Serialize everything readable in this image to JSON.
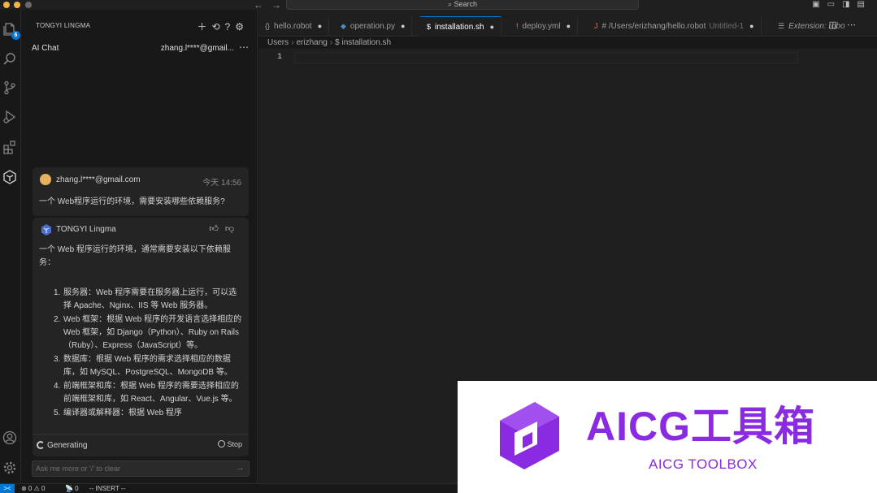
{
  "titlebar": {
    "search_placeholder": "Search",
    "colors": {
      "bg": "#1f1f1f",
      "traffic_dot": "#f2b449"
    }
  },
  "activity_bar": {
    "items": [
      {
        "icon": "files-icon",
        "badge": "6"
      },
      {
        "icon": "search-icon"
      },
      {
        "icon": "source-control-icon"
      },
      {
        "icon": "run-debug-icon"
      },
      {
        "icon": "extensions-icon"
      },
      {
        "icon": "tongyi-lingma-icon"
      }
    ],
    "bottom": [
      {
        "icon": "account-icon"
      },
      {
        "icon": "manage-gear-icon"
      }
    ]
  },
  "sidebar": {
    "header": "TONGYI LINGMA",
    "panel_title": "AI Chat",
    "account": "zhang.l****@gmail...",
    "user_message": {
      "author": "zhang.l****@gmail.com",
      "time": "今天 14:56",
      "text": "一个 Web程序运行的环境，需要安装哪些依赖服务?"
    },
    "ai_message": {
      "author": "TONGYI Lingma",
      "intro": "一个 Web 程序运行的环境，通常需要安装以下依赖服务：",
      "items": [
        {
          "num": "1.",
          "text": "服务器：Web 程序需要在服务器上运行，可以选择 Apache、Nginx、IIS 等 Web 服务器。"
        },
        {
          "num": "2.",
          "text": "Web 框架：根据 Web 程序的开发语言选择相应的 Web 框架，如 Django（Python）、Ruby on Rails（Ruby）、Express（JavaScript）等。"
        },
        {
          "num": "3.",
          "text": "数据库：根据 Web 程序的需求选择相应的数据库，如 MySQL、PostgreSQL、MongoDB 等。"
        },
        {
          "num": "4.",
          "text": "前端框架和库：根据 Web 程序的需要选择相应的前端框架和库，如 React、Angular、Vue.js 等。"
        },
        {
          "num": "5.",
          "text": "编译器或解释器：根据 Web 程序"
        }
      ],
      "status": "Generating",
      "stop_label": "Stop"
    },
    "input_placeholder": "Ask me more or '/' to clear"
  },
  "editor": {
    "tabs": [
      {
        "icon": "{}",
        "label": "hello.robot",
        "dirty": "●"
      },
      {
        "icon": "◆",
        "label": "operation.py",
        "dirty": "●"
      },
      {
        "icon": "$",
        "label": "installation.sh",
        "dirty": "●",
        "active": true
      },
      {
        "icon": "!",
        "label": "deploy.yml",
        "dirty": "●"
      },
      {
        "icon": "J",
        "label": "# /Users/erizhang/hello.robot",
        "sub": "Untitled-1",
        "dirty": "●"
      },
      {
        "icon": "☰",
        "label": "Extension: robo"
      }
    ],
    "breadcrumb": [
      "Users",
      "erizhang",
      "$ installation.sh"
    ],
    "line_number": "1"
  },
  "statusbar": {
    "remote": "><",
    "problems": "⊗ 0 ⚠ 0",
    "ports": "📡 0",
    "mode": "-- INSERT --"
  },
  "watermark": {
    "title": "AICG工具箱",
    "subtitle": "AICG TOOLBOX",
    "color": "#8a2be2"
  }
}
